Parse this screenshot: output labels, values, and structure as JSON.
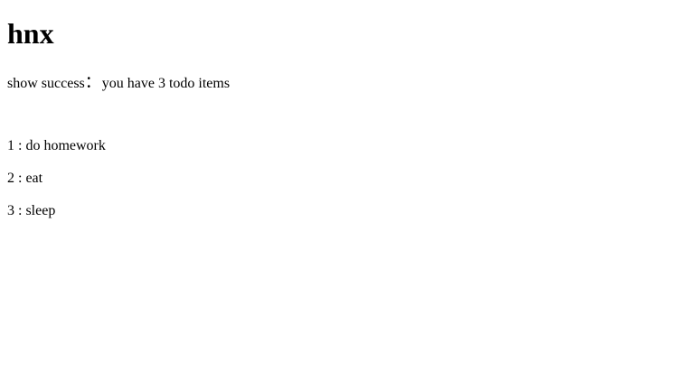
{
  "title": "hnx",
  "status": {
    "label": "show success",
    "separator": "：",
    "message": "you have 3 todo items"
  },
  "todos": [
    {
      "index": "1",
      "sep": " : ",
      "text": "do homework"
    },
    {
      "index": "2",
      "sep": " : ",
      "text": "eat"
    },
    {
      "index": "3",
      "sep": " : ",
      "text": "sleep"
    }
  ]
}
